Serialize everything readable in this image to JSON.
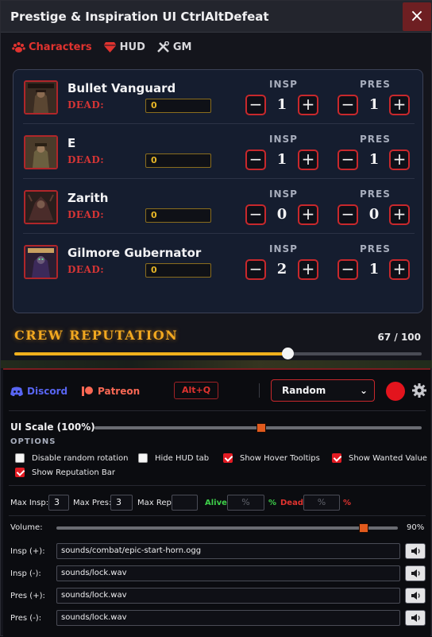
{
  "window": {
    "title": "Prestige & Inspiration UI CtrlAltDefeat",
    "close_label": "×"
  },
  "tabs": [
    {
      "label": "Characters",
      "icon": "paw-icon",
      "active": true
    },
    {
      "label": "HUD",
      "icon": "gem-icon",
      "active": false
    },
    {
      "label": "GM",
      "icon": "tools-icon",
      "active": false
    }
  ],
  "characters": {
    "insp_label": "INSP",
    "pres_label": "PRES",
    "dead_label": "DEAD:",
    "minus_label": "−",
    "plus_label": "+",
    "list": [
      {
        "name": "Bullet Vanguard",
        "dead": "0",
        "insp": "1",
        "pres": "1"
      },
      {
        "name": "E",
        "dead": "0",
        "insp": "1",
        "pres": "1"
      },
      {
        "name": "Zarith",
        "dead": "0",
        "insp": "0",
        "pres": "0"
      },
      {
        "name": "Gilmore Gubernator",
        "dead": "0",
        "insp": "2",
        "pres": "1"
      }
    ]
  },
  "crew": {
    "title": "CREW REPUTATION",
    "count": "67 / 100",
    "value": 67,
    "max": 100
  },
  "links": {
    "discord": "Discord",
    "patreon": "Patreon",
    "hotkey": "Alt+Q"
  },
  "rotation_select": {
    "value": "Random"
  },
  "ui_scale": {
    "label": "UI Scale (100%)",
    "fraction": 0.51
  },
  "options": {
    "title": "OPTIONS",
    "items": [
      {
        "label": "Disable random rotation",
        "checked": false
      },
      {
        "label": "Hide HUD tab",
        "checked": false
      },
      {
        "label": "Show Hover Tooltips",
        "checked": true
      },
      {
        "label": "Show Wanted Value",
        "checked": true
      },
      {
        "label": "Show Reputation Bar",
        "checked": true
      }
    ]
  },
  "limits": {
    "max_insp_label": "Max Insp:",
    "max_insp": "3",
    "max_pres_label": "Max Pres:",
    "max_pres": "3",
    "max_rep_label": "Max Rep:",
    "max_rep": "",
    "alive_label": "Alive:",
    "alive_placeholder": "%",
    "alive_pct": "%",
    "dead_label": "Dead:",
    "dead_placeholder": "%",
    "dead_pct": "%"
  },
  "volume": {
    "label": "Volume:",
    "value": "90%",
    "fraction": 0.9
  },
  "sounds": [
    {
      "label": "Insp (+):",
      "path": "sounds/combat/epic-start-horn.ogg"
    },
    {
      "label": "Insp (-):",
      "path": "sounds/lock.wav"
    },
    {
      "label": "Pres (+):",
      "path": "sounds/lock.wav"
    },
    {
      "label": "Pres (-):",
      "path": "sounds/lock.wav"
    }
  ],
  "colors": {
    "accent": "#e0332f",
    "gold": "#f0b01c",
    "orange": "#e25a1d",
    "discord": "#5865f2",
    "patreon": "#f96854"
  }
}
